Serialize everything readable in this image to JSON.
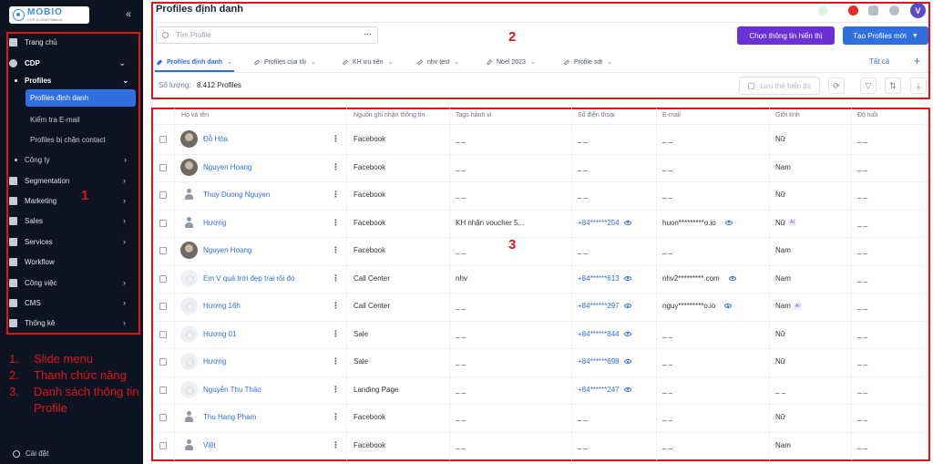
{
  "sidebar": {
    "logo_title": "MOBIO",
    "logo_subtitle": "CDP & CEM Platform",
    "collapse_symbol": "«",
    "items": [
      {
        "label": "Trang chủ",
        "icon": "home-icon"
      },
      {
        "label": "CDP",
        "icon": "person-icon"
      },
      {
        "label": "Profiles"
      },
      {
        "label": "Profiles định danh"
      },
      {
        "label": "Kiểm tra E-mail"
      },
      {
        "label": "Profiles bị chặn contact"
      },
      {
        "label": "Công ty"
      },
      {
        "label": "Segmentation",
        "icon": "segment-icon"
      },
      {
        "label": "Marketing",
        "icon": "megaphone-icon"
      },
      {
        "label": "Sales",
        "icon": "box-icon"
      },
      {
        "label": "Services",
        "icon": "people-icon"
      },
      {
        "label": "Workflow",
        "icon": "workflow-icon"
      },
      {
        "label": "Công việc",
        "icon": "task-icon"
      },
      {
        "label": "CMS",
        "icon": "monitor-icon"
      },
      {
        "label": "Thống kê",
        "icon": "chart-icon"
      }
    ],
    "settings_label": "Cài đặt"
  },
  "annotations": {
    "box1": "1",
    "box2": "2",
    "box3": "3",
    "legend": [
      {
        "num": "1.",
        "text": "Slide menu"
      },
      {
        "num": "2.",
        "text": "Thanh chức năng"
      },
      {
        "num": "3.",
        "text": "Danh sách thông tin Profile"
      }
    ]
  },
  "header": {
    "title": "Profiles định danh",
    "avatar_letter": "V",
    "search_placeholder": "Tìm Profile",
    "search_more": "···",
    "btn_select_info": "Chọn thông tin hiển thị",
    "btn_create": "Tạo Profiles mới",
    "tabs": [
      {
        "label": "Profiles định danh",
        "active": true
      },
      {
        "label": "Profiles của tôi"
      },
      {
        "label": "KH ưu tiên"
      },
      {
        "label": "nhv test"
      },
      {
        "label": "Noel 2023"
      },
      {
        "label": "Profile sdt"
      }
    ],
    "all_label": "Tất cả",
    "plus": "+",
    "count_label": "Số lượng:",
    "count_value": "8.412 Profiles",
    "save_view": "Lưu thẻ hiển thị"
  },
  "table": {
    "columns": [
      "Họ và tên",
      "Nguồn ghi nhận thông tin",
      "Tags hành vi",
      "Số điện thoại",
      "E-mail",
      "Giới tính",
      "Độ tuổi"
    ],
    "rows": [
      {
        "name": "Đỗ Hòa",
        "avatar": "photo",
        "source": "Facebook",
        "tags": "_ _",
        "phone": "_ _",
        "email": "_ _",
        "gender": "Nữ",
        "age": "_ _"
      },
      {
        "name": "Nguyen Hoang",
        "avatar": "photo",
        "source": "Facebook",
        "tags": "_ _",
        "phone": "_ _",
        "email": "_ _",
        "gender": "Nam",
        "age": "_ _"
      },
      {
        "name": "Thuy Duong Nguyen",
        "avatar": "person",
        "source": "Facebook",
        "tags": "_ _",
        "phone": "_ _",
        "email": "_ _",
        "gender": "Nữ",
        "age": "_ _"
      },
      {
        "name": "Hương",
        "avatar": "person",
        "source": "Facebook",
        "tags": "KH nhận voucher 5...",
        "phone": "+84******254",
        "email": "huon*********o.io",
        "gender": "Nữ",
        "gender_badge": "AI",
        "age": "_ _"
      },
      {
        "name": "Nguyen Hoang",
        "avatar": "photo",
        "source": "Facebook",
        "tags": "_ _",
        "phone": "_ _",
        "email": "_ _",
        "gender": "Nam",
        "age": "_ _"
      },
      {
        "name": "Em V quá trời đẹp trai rồi đó",
        "avatar": "blank",
        "source": "Call Center",
        "tags": "nhv",
        "phone": "+84******613",
        "email": "nhv2*********.com",
        "gender": "Nam",
        "age": "_ _"
      },
      {
        "name": "Hương 16h",
        "avatar": "blank",
        "source": "Call Center",
        "tags": "_ _",
        "phone": "+84******297",
        "email": "nguy*********o.io",
        "gender": "Nam",
        "gender_badge": "AI",
        "age": "_ _"
      },
      {
        "name": "Hương 01",
        "avatar": "blank",
        "source": "Sale",
        "tags": "_ _",
        "phone": "+84******844",
        "email": "_ _",
        "gender": "Nữ",
        "age": "_ _"
      },
      {
        "name": "Hương",
        "avatar": "blank",
        "source": "Sale",
        "tags": "_ _",
        "phone": "+84******698",
        "email": "_ _",
        "gender": "Nữ",
        "age": "_ _"
      },
      {
        "name": "Nguyễn Thu Thảo",
        "avatar": "blank",
        "source": "Landing Page",
        "tags": "_ _",
        "phone": "+84******247",
        "email": "_ _",
        "gender": "_ _",
        "age": "_ _"
      },
      {
        "name": "Thu Hang Pham",
        "avatar": "person",
        "source": "Facebook",
        "tags": "_ _",
        "phone": "_ _",
        "email": "_ _",
        "gender": "Nữ",
        "age": "_ _"
      },
      {
        "name": "Việt",
        "avatar": "person",
        "source": "Facebook",
        "tags": "_ _",
        "phone": "_ _",
        "email": "_ _",
        "gender": "Nam",
        "age": "_ _"
      }
    ]
  },
  "colors": {
    "accent": "#2f6fe0",
    "purple": "#6a32d6",
    "annotation_red": "#e0151b",
    "sidebar_bg": "#0b1420"
  }
}
